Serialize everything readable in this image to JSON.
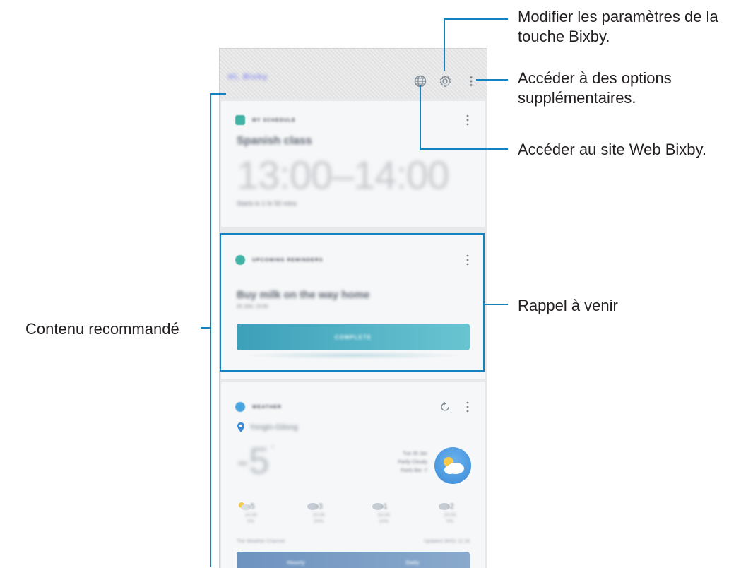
{
  "callouts": {
    "settings": [
      "Modifier les paramètres de la",
      "touche Bixby."
    ],
    "more_options": [
      "Accéder à des options",
      "supplémentaires."
    ],
    "website": "Accéder au site Web Bixby.",
    "reminder": "Rappel à venir",
    "recommended": "Contenu recommandé"
  },
  "phone": {
    "brand": "Hi, Bixby",
    "icons": [
      "globe-icon",
      "gear-icon",
      "more-vertical-icon"
    ]
  },
  "schedule_card": {
    "label": "MY SCHEDULE",
    "event": "Spanish class",
    "time": "13:00–14:00",
    "note": "Starts in 1 hr 50 mins"
  },
  "reminder_card": {
    "label": "UPCOMING REMINDERS",
    "text": "Buy milk on the way home",
    "date": "30 JAN, 15:00",
    "button": "COMPLETE"
  },
  "weather_card": {
    "label": "WEATHER",
    "location": "Yongin-Gilong",
    "temp": "-5",
    "deg": "°",
    "summary": [
      "Tue 30 Jan",
      "Partly Cloudy",
      "Feels like -7"
    ],
    "forecast": [
      {
        "temp": "-5",
        "time": "14:00",
        "pop": "0%"
      },
      {
        "temp": "-3",
        "time": "15:00",
        "pop": "20%"
      },
      {
        "temp": "-1",
        "time": "16:00",
        "pop": "10%"
      },
      {
        "temp": "-2",
        "time": "20:00",
        "pop": "0%"
      }
    ],
    "source": "The Weather Channel",
    "updated": "Updated 30/01 11:18",
    "footer": [
      "Hourly",
      "Daily"
    ],
    "accent": "#3a8ad8"
  },
  "colors": {
    "highlight": "#1582bf",
    "teal": "#43b3a5",
    "button": "#3da0b9"
  }
}
